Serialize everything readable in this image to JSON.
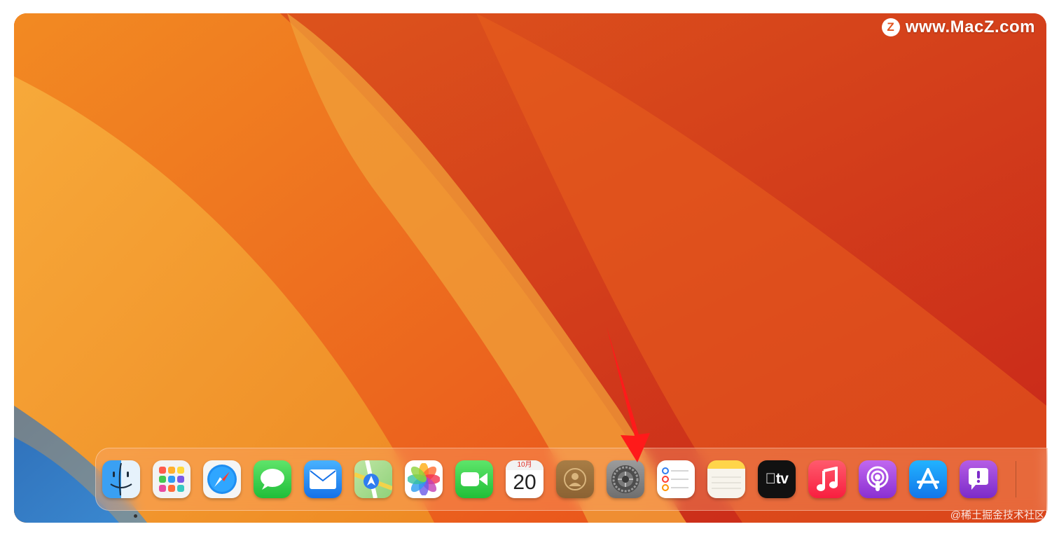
{
  "watermark": {
    "badge": "Z",
    "text": "www.MacZ.com"
  },
  "credit": "@稀土掘金技术社区",
  "dock": {
    "items": [
      {
        "name": "Finder",
        "icon": "finder-icon",
        "running": true
      },
      {
        "name": "Launchpad",
        "icon": "launchpad-icon"
      },
      {
        "name": "Safari",
        "icon": "safari-icon"
      },
      {
        "name": "Messages",
        "icon": "messages-icon"
      },
      {
        "name": "Mail",
        "icon": "mail-icon"
      },
      {
        "name": "Maps",
        "icon": "maps-icon"
      },
      {
        "name": "Photos",
        "icon": "photos-icon"
      },
      {
        "name": "FaceTime",
        "icon": "facetime-icon"
      },
      {
        "name": "Calendar",
        "icon": "calendar-icon",
        "month": "10月",
        "day": "20"
      },
      {
        "name": "Contacts",
        "icon": "contacts-icon"
      },
      {
        "name": "System Settings",
        "icon": "gear-icon",
        "highlighted": true
      },
      {
        "name": "Reminders",
        "icon": "reminders-icon"
      },
      {
        "name": "Notes",
        "icon": "notes-icon"
      },
      {
        "name": "TV",
        "icon": "tv-icon",
        "label": "tv"
      },
      {
        "name": "Music",
        "icon": "music-icon"
      },
      {
        "name": "Podcasts",
        "icon": "podcasts-icon"
      },
      {
        "name": "App Store",
        "icon": "app-store-icon"
      },
      {
        "name": "Feedback Assistant",
        "icon": "feedback-icon"
      }
    ]
  },
  "colors": {
    "annotation_arrow": "#ff1a1a",
    "wallpaper_light": "#f6a534",
    "wallpaper_dark": "#c22218"
  }
}
